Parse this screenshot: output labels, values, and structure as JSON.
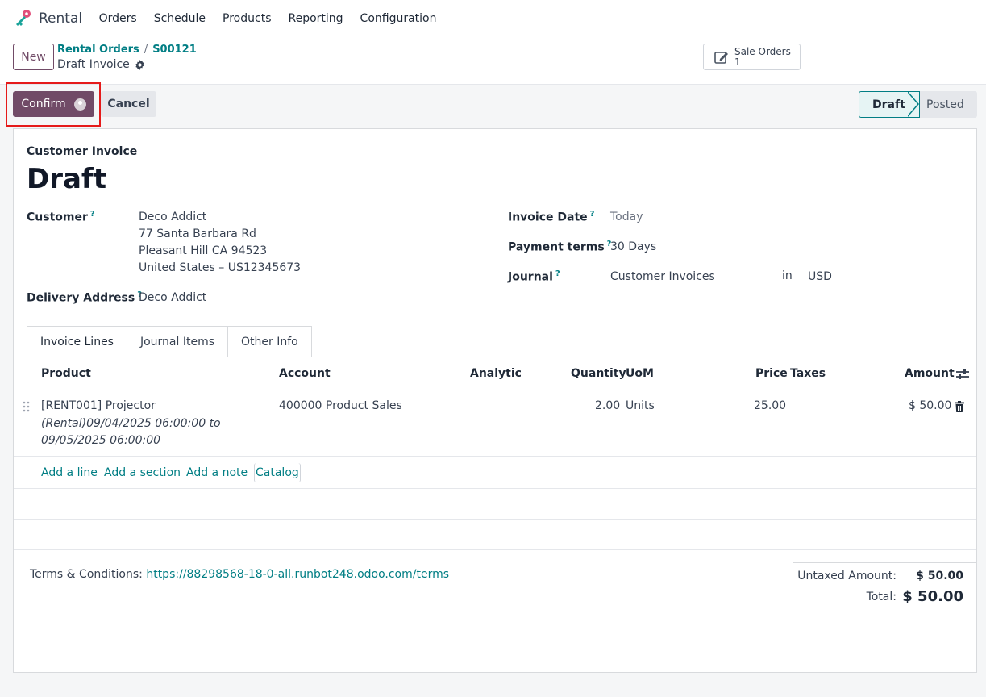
{
  "app": {
    "name": "Rental",
    "menu": [
      "Orders",
      "Schedule",
      "Products",
      "Reporting",
      "Configuration"
    ]
  },
  "control": {
    "new_label": "New",
    "breadcrumb": [
      "Rental Orders",
      "S00121"
    ],
    "record_name": "Draft Invoice",
    "smart_button": {
      "label": "Sale Orders",
      "count": "1",
      "icon": "edit-icon"
    }
  },
  "statusbar": {
    "confirm_label": "Confirm",
    "cancel_label": "Cancel",
    "stages": [
      "Draft",
      "Posted"
    ],
    "current_stage": "Draft"
  },
  "invoice": {
    "type": "Customer Invoice",
    "title": "Draft",
    "customer_label": "Customer",
    "customer_lines": [
      "Deco Addict",
      "77 Santa Barbara Rd",
      "Pleasant Hill CA 94523",
      "United States – US12345673"
    ],
    "delivery_label": "Delivery Address",
    "delivery_value": "Deco Addict",
    "invoice_date_label": "Invoice Date",
    "invoice_date_placeholder": "Today",
    "payment_terms_label": "Payment terms",
    "payment_terms_value": "30 Days",
    "journal_label": "Journal",
    "journal_value": "Customer Invoices",
    "journal_in": "in",
    "currency": "USD",
    "help_mark": "?"
  },
  "tabs": [
    "Invoice Lines",
    "Journal Items",
    "Other Info"
  ],
  "lines": {
    "headers": {
      "product": "Product",
      "account": "Account",
      "analytic": "Analytic",
      "quantity": "Quantity",
      "uom": "UoM",
      "price": "Price",
      "taxes": "Taxes",
      "amount": "Amount"
    },
    "rows": [
      {
        "product": "[RENT001] Projector",
        "description": "(Rental)09/04/2025 06:00:00 to 09/05/2025 06:00:00",
        "account": "400000 Product Sales",
        "analytic": "",
        "quantity": "2.00",
        "uom": "Units",
        "price": "25.00",
        "taxes": "",
        "amount": "$ 50.00"
      }
    ],
    "add_line": "Add a line",
    "add_section": "Add a section",
    "add_note": "Add a note",
    "catalog": "Catalog"
  },
  "footer": {
    "terms_label": "Terms & Conditions:",
    "terms_link": "https://88298568-18-0-all.runbot248.odoo.com/terms",
    "untaxed_label": "Untaxed Amount:",
    "untaxed_value": "$ 50.00",
    "total_label": "Total:",
    "total_value": "$ 50.00"
  },
  "colors": {
    "brand": "#714b67",
    "link": "#017e84",
    "highlight": "#e51a1a"
  }
}
